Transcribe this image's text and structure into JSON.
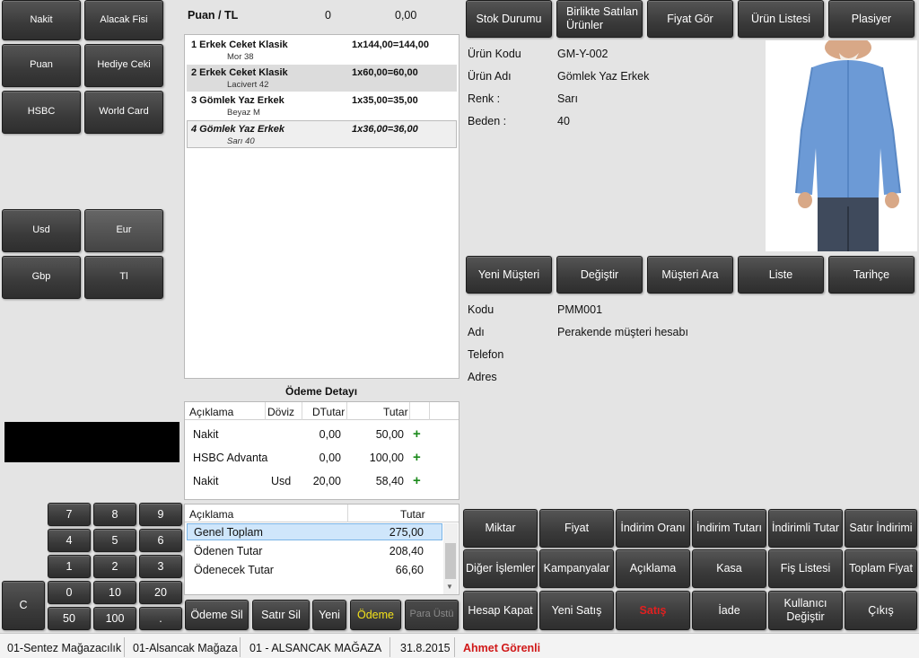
{
  "payment_methods": [
    "Nakit",
    "Alacak Fisi",
    "Puan",
    "Hediye Ceki",
    "HSBC",
    "World Card"
  ],
  "currencies": [
    "Usd",
    "Eur",
    "Gbp",
    "Tl"
  ],
  "points_header": {
    "label": "Puan / TL",
    "points": "0",
    "amount": "0,00"
  },
  "cart_items": [
    {
      "title": "1 Erkek Ceket Klasik",
      "sub": "Mor 38",
      "calc": "1x144,00=144,00"
    },
    {
      "title": "2 Erkek Ceket Klasik",
      "sub": "Lacivert 42",
      "calc": "1x60,00=60,00"
    },
    {
      "title": "3 Gömlek Yaz Erkek",
      "sub": "Beyaz M",
      "calc": "1x35,00=35,00"
    },
    {
      "title": "4 Gömlek Yaz Erkek",
      "sub": "Sarı 40",
      "calc": "1x36,00=36,00"
    }
  ],
  "payment_detail": {
    "title": "Ödeme Detayı",
    "headers": [
      "Açıklama",
      "Döviz",
      "DTutar",
      "Tutar"
    ],
    "rows": [
      {
        "desc": "Nakit",
        "currency": "",
        "dtutar": "0,00",
        "tutar": "50,00"
      },
      {
        "desc": "HSBC Advanta",
        "currency": "",
        "dtutar": "0,00",
        "tutar": "100,00"
      },
      {
        "desc": "Nakit",
        "currency": "Usd",
        "dtutar": "20,00",
        "tutar": "58,40"
      }
    ]
  },
  "totals": {
    "headers": [
      "Açıklama",
      "Tutar"
    ],
    "rows": [
      {
        "label": "Genel Toplam",
        "value": "275,00"
      },
      {
        "label": "Ödenen Tutar",
        "value": "208,40"
      },
      {
        "label": "Ödenecek Tutar",
        "value": "66,60"
      }
    ]
  },
  "action_buttons": [
    "Ödeme Sil",
    "Satır Sil",
    "Yeni",
    "Ödeme",
    "Para Üstü"
  ],
  "keypad": {
    "digits": [
      "7",
      "8",
      "9",
      "4",
      "5",
      "6",
      "1",
      "2",
      "3",
      "0",
      "10",
      "20",
      "50",
      "100",
      "."
    ],
    "clear": "C"
  },
  "product_toolbar": [
    "Stok Durumu",
    "Birlikte Satılan Ürünler",
    "Fiyat Gör",
    "Ürün Listesi",
    "Plasiyer"
  ],
  "product_info": [
    {
      "label": "Ürün Kodu",
      "value": "GM-Y-002"
    },
    {
      "label": "Ürün Adı",
      "value": "Gömlek Yaz Erkek"
    },
    {
      "label": "Renk :",
      "value": "Sarı"
    },
    {
      "label": "Beden :",
      "value": "40"
    }
  ],
  "customer_toolbar": [
    "Yeni Müşteri",
    "Değiştir",
    "Müşteri Ara",
    "Liste",
    "Tarihçe"
  ],
  "customer_info": [
    {
      "label": "Kodu",
      "value": "PMM001"
    },
    {
      "label": "Adı",
      "value": "Perakende müşteri hesabı"
    },
    {
      "label": "Telefon",
      "value": ""
    },
    {
      "label": "Adres",
      "value": ""
    }
  ],
  "function_grid": [
    [
      "Miktar",
      "Fiyat",
      "İndirim Oranı",
      "İndirim Tutarı",
      "İndirimli Tutar",
      "Satır İndirimi"
    ],
    [
      "Diğer İşlemler",
      "Kampanyalar",
      "Açıklama",
      "Kasa",
      "Fiş Listesi",
      "Toplam Fiyat"
    ],
    [
      "Hesap Kapat",
      "Yeni Satış",
      "Satış",
      "İade",
      "Kullanıcı Değiştir",
      "Çıkış"
    ]
  ],
  "status_bar": [
    "01-Sentez Mağazacılık",
    "01-Alsancak Mağaza",
    "01 - ALSANCAK MAĞAZA",
    "31.8.2015",
    "Ahmet Görenli"
  ],
  "colors": {
    "accent_yellow": "#f4e21a",
    "alert_red": "#e02020",
    "selection_blue": "#cfe6fb",
    "plus_green": "#1c8a1c"
  }
}
